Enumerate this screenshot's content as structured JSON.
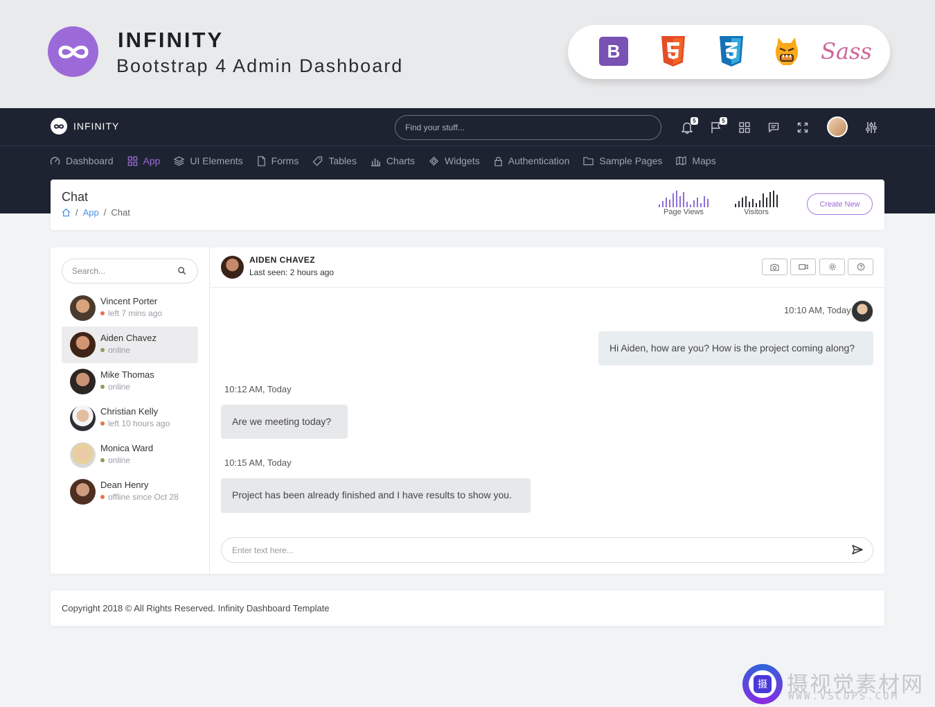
{
  "promo": {
    "title": "INFINITY",
    "subtitle": "Bootstrap 4 Admin Dashboard",
    "tech_icons": [
      "bootstrap-icon",
      "html5-icon",
      "css3-icon",
      "grunt-icon",
      "sass-icon"
    ],
    "bootstrap_letter": "B",
    "sass_word": "Sass"
  },
  "nav": {
    "brand": "INFINITY",
    "search_placeholder": "Find your stuff...",
    "notifications_count": "5",
    "flags_count": "5",
    "menu": [
      {
        "label": "Dashboard",
        "icon": "dashboard-icon"
      },
      {
        "label": "App",
        "icon": "grid-icon"
      },
      {
        "label": "UI Elements",
        "icon": "layers-icon"
      },
      {
        "label": "Forms",
        "icon": "file-icon"
      },
      {
        "label": "Tables",
        "icon": "tag-icon"
      },
      {
        "label": "Charts",
        "icon": "bar-chart-icon"
      },
      {
        "label": "Widgets",
        "icon": "widget-icon"
      },
      {
        "label": "Authentication",
        "icon": "lock-icon"
      },
      {
        "label": "Sample Pages",
        "icon": "folder-icon"
      },
      {
        "label": "Maps",
        "icon": "map-icon"
      }
    ],
    "active_color": "#9c6ad8"
  },
  "page": {
    "title": "Chat",
    "breadcrumb": [
      "App",
      "Chat"
    ],
    "page_views_label": "Page Views",
    "visitors_label": "Visitors",
    "create_label": "Create New"
  },
  "sidebar": {
    "search_placeholder": "Search...",
    "contacts": [
      {
        "name": "Vincent Porter",
        "status": "left 7 mins ago",
        "state": "away"
      },
      {
        "name": "Aiden Chavez",
        "status": "online",
        "state": "online"
      },
      {
        "name": "Mike Thomas",
        "status": "online",
        "state": "online"
      },
      {
        "name": "Christian Kelly",
        "status": "left 10 hours ago",
        "state": "away"
      },
      {
        "name": "Monica Ward",
        "status": "online",
        "state": "online"
      },
      {
        "name": "Dean Henry",
        "status": "offline since Oct 28",
        "state": "away"
      }
    ],
    "status_colors": {
      "online": "#8aa05a",
      "away": "#e8744a"
    }
  },
  "conversation": {
    "name": "AIDEN CHAVEZ",
    "last_seen": "Last seen: 2 hours ago",
    "messages": [
      {
        "time": "10:10 AM, Today",
        "text": "Hi Aiden, how are you? How is the project coming along?",
        "from": "me"
      },
      {
        "time": "10:12 AM, Today",
        "text": "Are we meeting today?",
        "from": "them"
      },
      {
        "time": "10:15 AM, Today",
        "text": "Project has been already finished and I have results to show you.",
        "from": "them"
      }
    ],
    "input_placeholder": "Enter text here..."
  },
  "footer": {
    "text": "Copyright 2018 © All Rights Reserved. Infinity Dashboard Template"
  },
  "watermark": {
    "text": "摄视觉素材网",
    "url": "WWW.VSCOPS.COM",
    "glyph": "摄"
  }
}
